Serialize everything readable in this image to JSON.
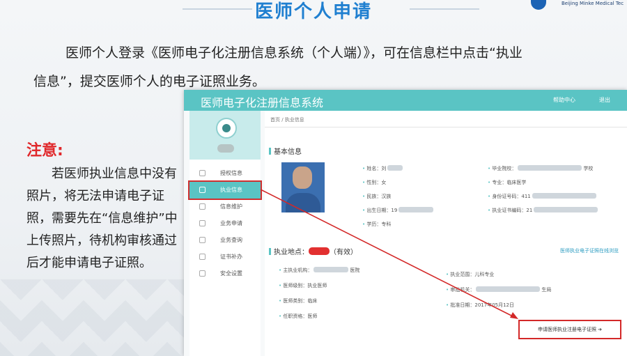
{
  "slide": {
    "title": "医师个人申请",
    "logo_text": "Beijing Minke Medical Tec",
    "intro_line1": "医师个人登录《医师电子化注册信息系统（个人端）》，可在信息栏中点击“执业",
    "intro_line2": "信息”，提交医师个人的电子证照业务。",
    "note_head": "注意:",
    "note_body": "若医师执业信息中没有照片，将无法申请电子证照，需要先在“信息维护”中上传照片，待机构审核通过后才能申请电子证照。"
  },
  "app": {
    "system_title": "医师电子化注册信息系统",
    "top_right": [
      "帮助中心",
      "退出"
    ],
    "sidebar": [
      {
        "label": "授权信息",
        "active": false
      },
      {
        "label": "执业信息",
        "active": true
      },
      {
        "label": "信息维护",
        "active": false
      },
      {
        "label": "业务申请",
        "active": false
      },
      {
        "label": "业务查询",
        "active": false
      },
      {
        "label": "证书补办",
        "active": false
      },
      {
        "label": "安全设置",
        "active": false
      }
    ],
    "breadcrumb": "首页 / 执业信息",
    "basic_info": {
      "title": "基本信息",
      "left": [
        {
          "label": "姓名：",
          "value": "刘"
        },
        {
          "label": "性别：",
          "value": "女"
        },
        {
          "label": "民族：",
          "value": "汉族"
        },
        {
          "label": "出生日期：",
          "value": "19"
        },
        {
          "label": "学历：",
          "value": "专科"
        }
      ],
      "right": [
        {
          "label": "毕业院校：",
          "value": "学校"
        },
        {
          "label": "专业：",
          "value": "临床医学"
        },
        {
          "label": "身份证号码：",
          "value": "411"
        },
        {
          "label": "执业证书编码：",
          "value": "21"
        }
      ]
    },
    "practice": {
      "title_prefix": "执业地点：",
      "title_suffix": "（有效）",
      "link": "医师执业电子证照在线浏览",
      "left": [
        {
          "label": "主执业机构：",
          "value": "医院"
        },
        {
          "label": "医师级别：",
          "value": "执业医师"
        },
        {
          "label": "医师类别：",
          "value": "临床"
        },
        {
          "label": "任职资格：",
          "value": "医师"
        }
      ],
      "right": [
        {
          "label": "执业范围：",
          "value": "儿科专业"
        },
        {
          "label": "审批机关：",
          "value": "生局"
        },
        {
          "label": "批准日期：",
          "value": "2017年05月12日"
        }
      ],
      "apply_button": "申请医师执业注册电子证照 ➔"
    }
  },
  "colors": {
    "accent": "#5ac4c4",
    "title": "#1f7fd0",
    "highlight": "#d32828"
  }
}
